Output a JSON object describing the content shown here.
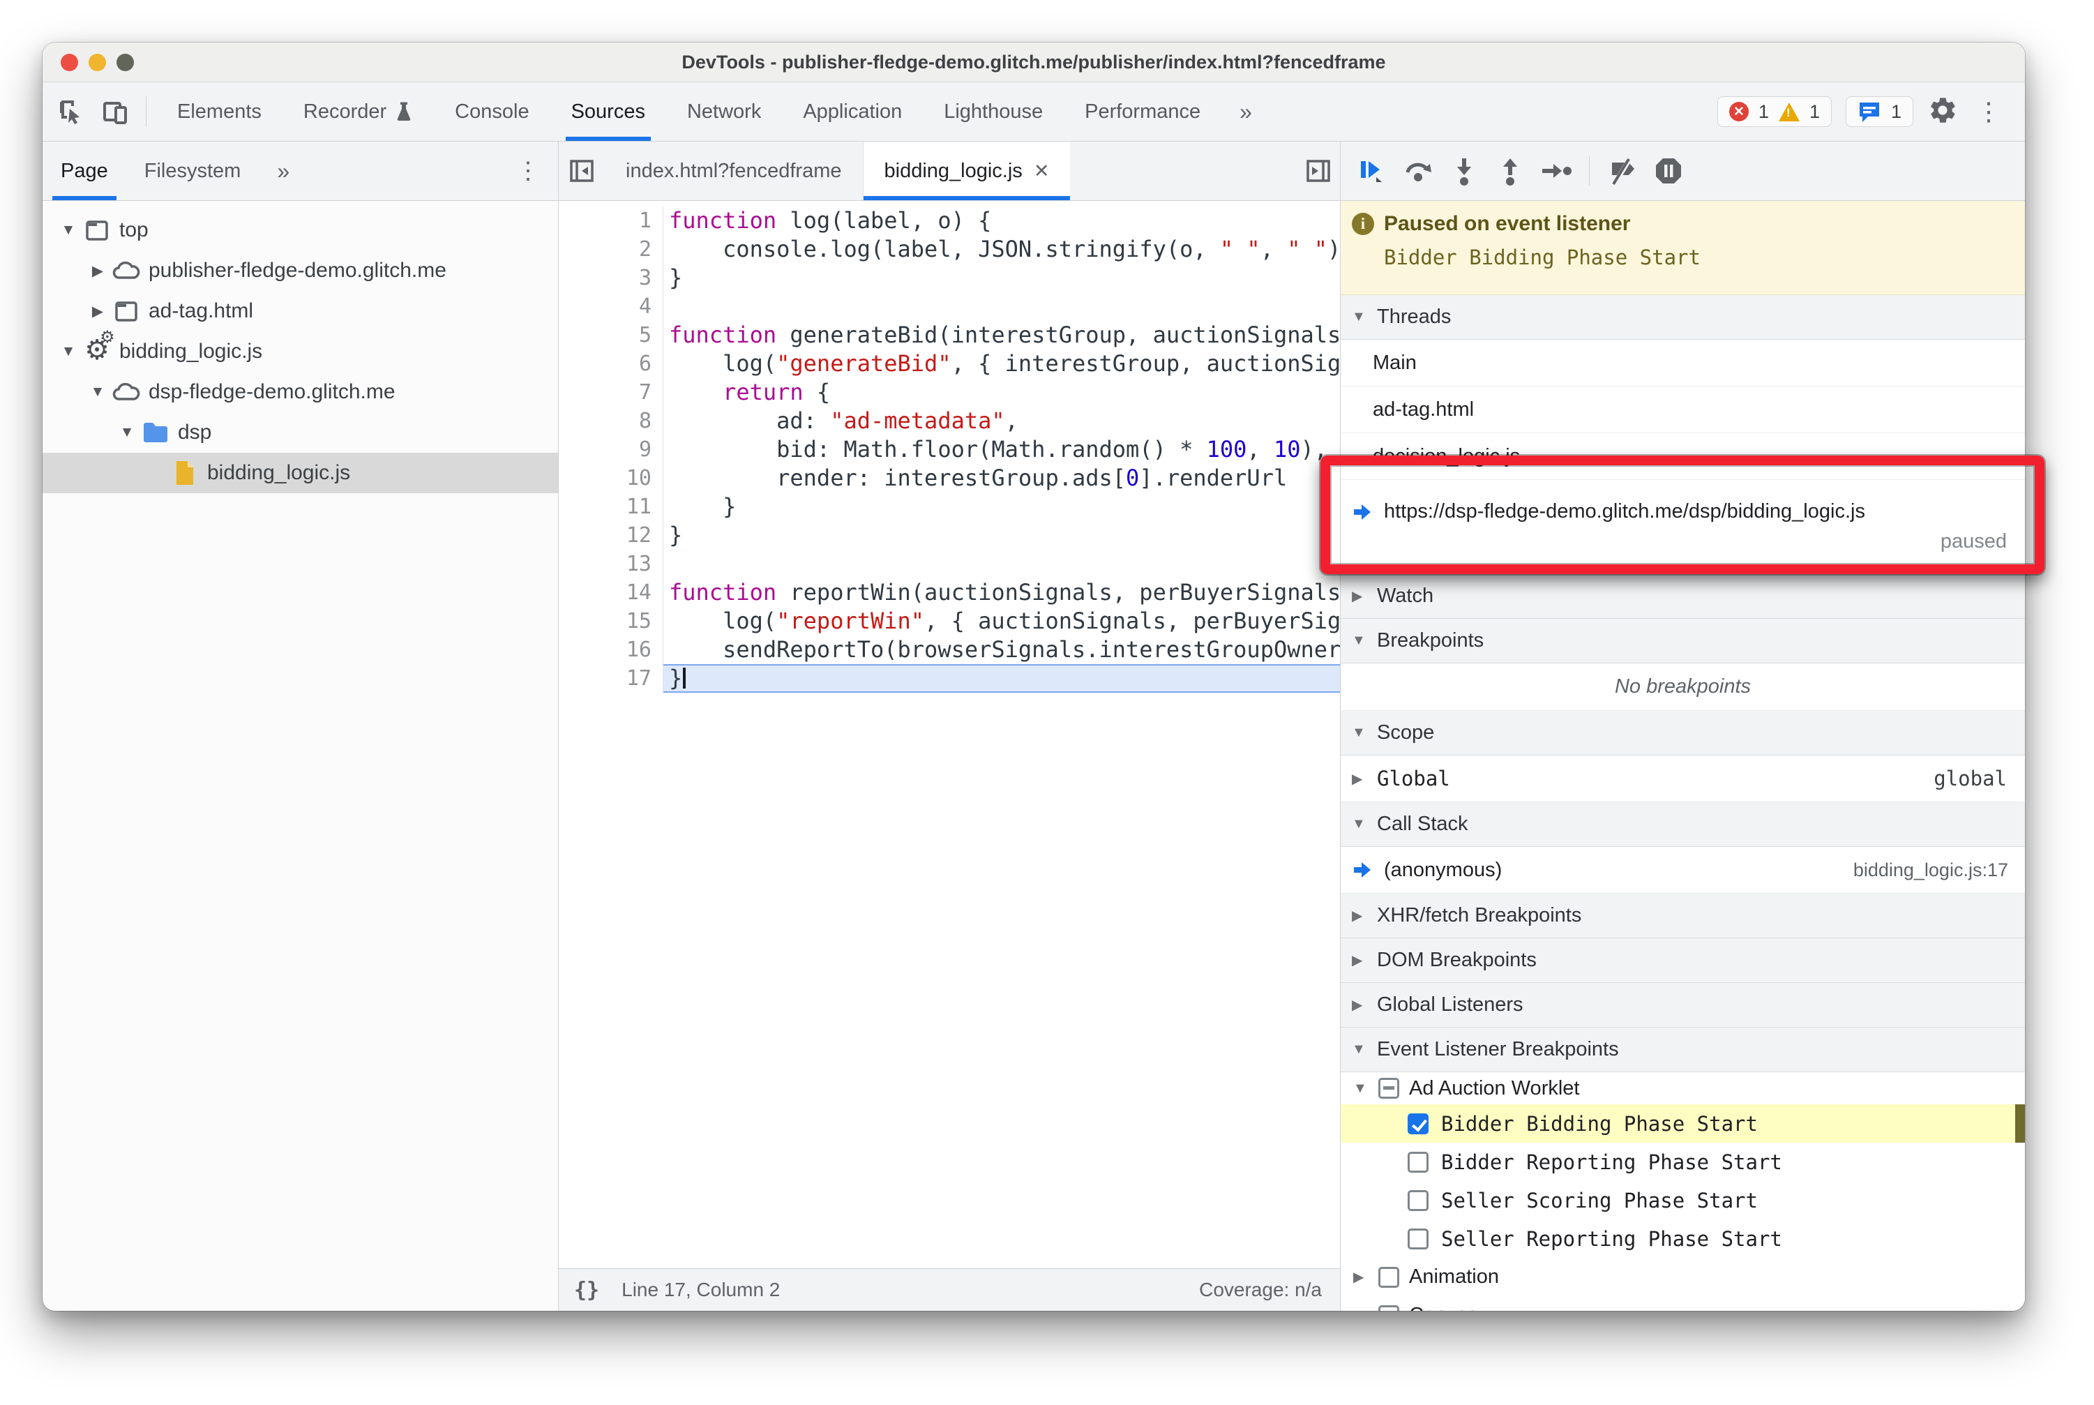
{
  "window": {
    "title": "DevTools - publisher-fledge-demo.glitch.me/publisher/index.html?fencedframe"
  },
  "main_toolbar": {
    "tabs": [
      {
        "label": "Elements",
        "active": false,
        "icon": null
      },
      {
        "label": "Recorder",
        "active": false,
        "icon": "flask-icon"
      },
      {
        "label": "Console",
        "active": false,
        "icon": null
      },
      {
        "label": "Sources",
        "active": true,
        "icon": null
      },
      {
        "label": "Network",
        "active": false,
        "icon": null
      },
      {
        "label": "Application",
        "active": false,
        "icon": null
      },
      {
        "label": "Lighthouse",
        "active": false,
        "icon": null
      },
      {
        "label": "Performance",
        "active": false,
        "icon": null
      }
    ],
    "more_tabs": "»",
    "error_count": "1",
    "warning_count": "1",
    "issue_count": "1"
  },
  "sidebar": {
    "tabs": [
      {
        "label": "Page",
        "active": true
      },
      {
        "label": "Filesystem",
        "active": false
      }
    ],
    "more_tabs": "»",
    "tree": [
      {
        "label": "top",
        "icon": "frame",
        "arrow": "open",
        "level": 0,
        "selected": false
      },
      {
        "label": "publisher-fledge-demo.glitch.me",
        "icon": "cloud",
        "arrow": "closed",
        "level": 1,
        "selected": false
      },
      {
        "label": "ad-tag.html",
        "icon": "frame",
        "arrow": "closed",
        "level": 1,
        "selected": false
      },
      {
        "label": "bidding_logic.js",
        "icon": "worker",
        "arrow": "open",
        "level": 0,
        "selected": false
      },
      {
        "label": "dsp-fledge-demo.glitch.me",
        "icon": "cloud",
        "arrow": "open",
        "level": 1,
        "selected": false
      },
      {
        "label": "dsp",
        "icon": "folder",
        "arrow": "open",
        "level": 2,
        "selected": false
      },
      {
        "label": "bidding_logic.js",
        "icon": "jsfile",
        "arrow": "none",
        "level": 3,
        "selected": true
      }
    ]
  },
  "editor": {
    "tabs": [
      {
        "label": "index.html?fencedframe",
        "active": false,
        "closable": false
      },
      {
        "label": "bidding_logic.js",
        "active": true,
        "closable": true
      }
    ],
    "close_glyph": "✕",
    "code_lines": [
      {
        "n": 1,
        "exec": false,
        "seg": [
          [
            "kw",
            "function"
          ],
          [
            "p",
            " log(label, o) {"
          ]
        ]
      },
      {
        "n": 2,
        "exec": false,
        "seg": [
          [
            "p",
            "    console.log(label, JSON.stringify(o, "
          ],
          [
            "str",
            "\" \""
          ],
          [
            "p",
            ", "
          ],
          [
            "str",
            "\" \""
          ],
          [
            "p",
            "))"
          ]
        ]
      },
      {
        "n": 3,
        "exec": false,
        "seg": [
          [
            "p",
            "}"
          ]
        ]
      },
      {
        "n": 4,
        "exec": false,
        "seg": []
      },
      {
        "n": 5,
        "exec": false,
        "seg": [
          [
            "kw",
            "function"
          ],
          [
            "p",
            " generateBid(interestGroup, auctionSignals, perBuyerSignals) {"
          ]
        ]
      },
      {
        "n": 6,
        "exec": false,
        "seg": [
          [
            "p",
            "    log("
          ],
          [
            "str",
            "\"generateBid\""
          ],
          [
            "p",
            ", { interestGroup, auctionSignals, perBuyerSignals });"
          ]
        ]
      },
      {
        "n": 7,
        "exec": false,
        "seg": [
          [
            "p",
            "    "
          ],
          [
            "kw",
            "return"
          ],
          [
            "p",
            " {"
          ]
        ]
      },
      {
        "n": 8,
        "exec": false,
        "seg": [
          [
            "p",
            "        ad: "
          ],
          [
            "str",
            "\"ad-metadata\""
          ],
          [
            "p",
            ","
          ]
        ]
      },
      {
        "n": 9,
        "exec": false,
        "seg": [
          [
            "p",
            "        bid: Math.floor(Math.random() * "
          ],
          [
            "num",
            "100"
          ],
          [
            "p",
            ", "
          ],
          [
            "num",
            "10"
          ],
          [
            "p",
            "),"
          ]
        ]
      },
      {
        "n": 10,
        "exec": false,
        "seg": [
          [
            "p",
            "        render: interestGroup.ads["
          ],
          [
            "num",
            "0"
          ],
          [
            "p",
            "].renderUrl"
          ]
        ]
      },
      {
        "n": 11,
        "exec": false,
        "seg": [
          [
            "p",
            "    }"
          ]
        ]
      },
      {
        "n": 12,
        "exec": false,
        "seg": [
          [
            "p",
            "}"
          ]
        ]
      },
      {
        "n": 13,
        "exec": false,
        "seg": []
      },
      {
        "n": 14,
        "exec": false,
        "seg": [
          [
            "kw",
            "function"
          ],
          [
            "p",
            " reportWin(auctionSignals, perBuyerSignals, sellerSignals, browserSignals) {"
          ]
        ]
      },
      {
        "n": 15,
        "exec": false,
        "seg": [
          [
            "p",
            "    log("
          ],
          [
            "str",
            "\"reportWin\""
          ],
          [
            "p",
            ", { auctionSignals, perBuyerSignals, sellerSignals });"
          ]
        ]
      },
      {
        "n": 16,
        "exec": false,
        "seg": [
          [
            "p",
            "    sendReportTo(browserSignals.interestGroupOwner);"
          ]
        ]
      },
      {
        "n": 17,
        "exec": true,
        "seg": [
          [
            "p",
            "}"
          ]
        ]
      }
    ],
    "status": {
      "brackets": "{}",
      "position": "Line 17, Column 2",
      "coverage": "Coverage: n/a"
    }
  },
  "debugger": {
    "paused": {
      "title": "Paused on event listener",
      "detail": "Bidder Bidding Phase Start"
    },
    "threads": {
      "header": "Threads",
      "items": [
        {
          "label": "Main",
          "status": "",
          "current": false
        },
        {
          "label": "ad-tag.html",
          "status": "",
          "current": false
        },
        {
          "label": "decision_logic.js",
          "status": "",
          "current": false
        },
        {
          "label": "https://dsp-fledge-demo.glitch.me/dsp/bidding_logic.js",
          "status": "paused",
          "current": true
        }
      ]
    },
    "sections": {
      "watch": "Watch",
      "breakpoints": "Breakpoints",
      "no_breakpoints": "No breakpoints",
      "scope": "Scope",
      "scope_global_label": "Global",
      "scope_global_value": "global",
      "call_stack": "Call Stack",
      "call_stack_frame": "(anonymous)",
      "call_stack_location": "bidding_logic.js:17",
      "xhr": "XHR/fetch Breakpoints",
      "dom": "DOM Breakpoints",
      "global_listeners": "Global Listeners",
      "event_listener_breakpoints": "Event Listener Breakpoints"
    },
    "event_tree": {
      "category": "Ad Auction Worklet",
      "category_state": "indeterminate",
      "events": [
        {
          "label": "Bidder Bidding Phase Start",
          "checked": true,
          "highlighted": true
        },
        {
          "label": "Bidder Reporting Phase Start",
          "checked": false,
          "highlighted": false
        },
        {
          "label": "Seller Scoring Phase Start",
          "checked": false,
          "highlighted": false
        },
        {
          "label": "Seller Reporting Phase Start",
          "checked": false,
          "highlighted": false
        }
      ],
      "categories_below": [
        {
          "label": "Animation",
          "checked": false
        },
        {
          "label": "Canvas",
          "checked": false
        }
      ]
    }
  },
  "colors": {
    "accent_blue": "#1a73e8",
    "annotation_red": "#f2202e",
    "paused_banner_bg": "#fcf6dc",
    "paused_banner_text": "#5d5416",
    "event_highlight_yellow": "#fffec2",
    "exec_line_blue": "#dde9fb",
    "syntax_keyword": "#aa0d91",
    "syntax_string": "#c41a16",
    "syntax_number": "#1c00cf",
    "error_red": "#e14138",
    "warning_yellow": "#e8a800"
  }
}
